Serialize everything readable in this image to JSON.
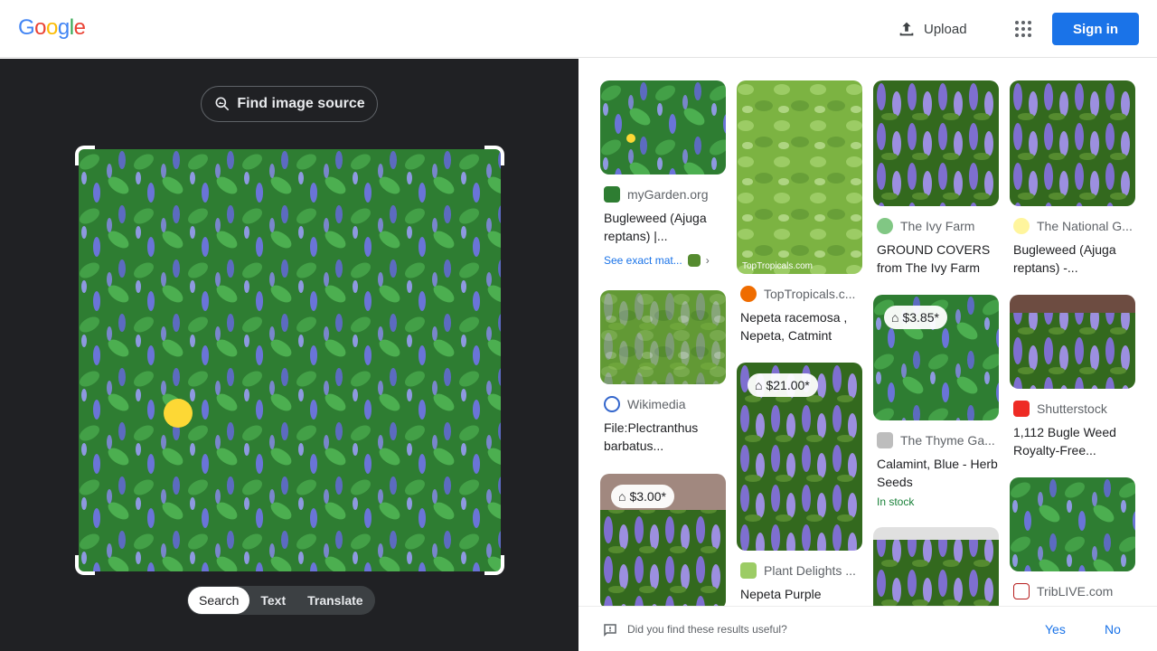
{
  "header": {
    "logo": "Google",
    "upload_label": "Upload",
    "signin_label": "Sign in"
  },
  "left": {
    "find_source_label": "Find image source",
    "modes": [
      "Search",
      "Text",
      "Translate"
    ],
    "active_mode": "Search"
  },
  "results": [
    {
      "source": "myGarden.org",
      "title": "Bugleweed (Ajuga reptans) |...",
      "exact": "See exact mat..."
    },
    {
      "source": "TopTropicals.c...",
      "title": "Nepeta racemosa , Nepeta, Catmint",
      "watermark": "TopTropicals.com"
    },
    {
      "source": "The Ivy Farm",
      "title": "GROUND COVERS from The Ivy Farm"
    },
    {
      "source": "The National G...",
      "title": "Bugleweed (Ajuga reptans) -..."
    },
    {
      "source": "Wikimedia",
      "title": "File:Plectranthus barbatus..."
    },
    {
      "source": "Plant Delights ...",
      "title": "Nepeta Purple",
      "price": "$21.00*"
    },
    {
      "source": "The Thyme Ga...",
      "title": "Calamint, Blue - Herb Seeds",
      "price": "$3.85*",
      "stock": "In stock"
    },
    {
      "source": "Shutterstock",
      "title": "1,112 Bugle Weed Royalty-Free..."
    },
    {
      "price": "$3.00*"
    },
    {},
    {
      "source": "TribLIVE.com"
    }
  ],
  "feedback": {
    "question": "Did you find these results useful?",
    "yes": "Yes",
    "no": "No"
  },
  "colors": {
    "accent": "#1a73e8",
    "dark_panel": "#202124",
    "stock_green": "#188038"
  }
}
